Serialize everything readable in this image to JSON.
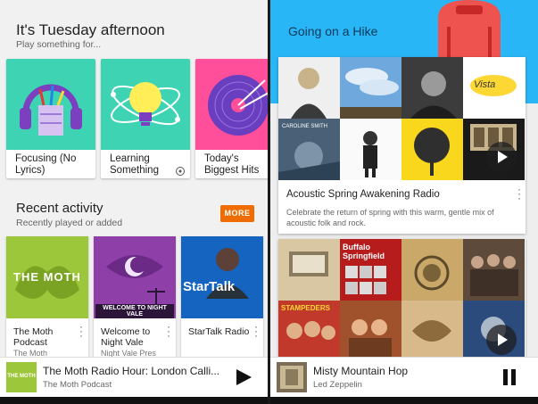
{
  "left": {
    "greeting": "It's Tuesday afternoon",
    "greeting_sub": "Play something for...",
    "activities": [
      {
        "label": "Focusing (No Lyrics)"
      },
      {
        "label": "Learning Something"
      },
      {
        "label": "Today's Biggest Hits"
      }
    ],
    "recent_title": "Recent activity",
    "recent_sub": "Recently played or added",
    "more_label": "MORE",
    "recent_items": [
      {
        "label": "The Moth Podcast",
        "sublabel": "The Moth",
        "art_text": "THE MOTH"
      },
      {
        "label": "Welcome to Night Vale",
        "sublabel": "Night Vale Pres",
        "art_text": "WELCOME TO NIGHT VALE"
      },
      {
        "label": "StarTalk Radio",
        "sublabel": "",
        "art_text": "StarTalk"
      }
    ],
    "player": {
      "title": "The Moth Radio Hour: London Calli...",
      "artist": "The Moth Podcast",
      "thumb_text": "THE MOTH"
    }
  },
  "right": {
    "header_title": "Going on a Hike",
    "station": {
      "title": "Acoustic Spring Awakening Radio",
      "description": "Celebrate the return of spring with this warm, gentle mix of acoustic folk and rock."
    },
    "album_texts": [
      "Vista",
      "CAROLINE SMITH",
      "Buffalo Springfield",
      "STAMPEDERS"
    ],
    "player": {
      "title": "Misty Mountain Hop",
      "artist": "Led Zeppelin"
    }
  },
  "colors": {
    "accent": "#ef6c00",
    "hike_blue": "#29b6f6"
  }
}
